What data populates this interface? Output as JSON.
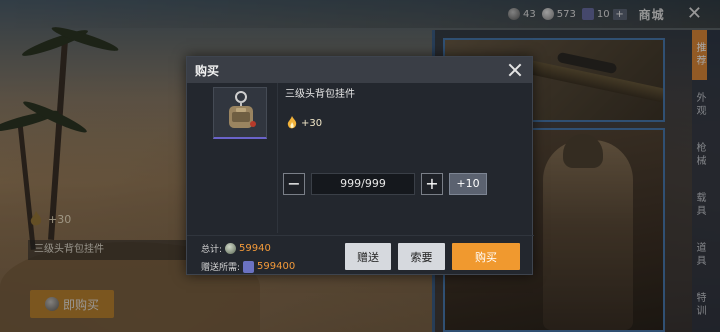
{
  "topbar": {
    "currency1": "43",
    "currency2": "573",
    "currency3": "10",
    "add": "+",
    "shop_title": "商城",
    "close": "✕"
  },
  "side_tabs": [
    "推荐",
    "外观",
    "枪械",
    "载具",
    "道具",
    "特训"
  ],
  "left_preview": {
    "bonus": "+30",
    "item_name": "三级头背包挂件",
    "buy_label": "即购买"
  },
  "dialog": {
    "title": "购买",
    "item_name": "三级头背包挂件",
    "bonus": "+30",
    "quantity": "999/999",
    "minus": "−",
    "plus": "+",
    "plus10": "+10",
    "total_label": "总计:",
    "total_value": "59940",
    "gift_label": "赠送所需:",
    "gift_value": "599400",
    "gift_btn": "赠送",
    "ask_btn": "索要",
    "buy_btn": "购买"
  },
  "colors": {
    "accent": "#f0992f",
    "dialog_bg": "#23272e",
    "price": "#f39a3a"
  }
}
